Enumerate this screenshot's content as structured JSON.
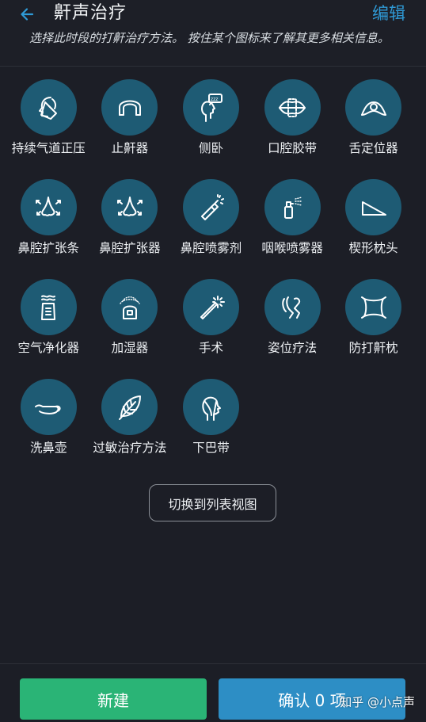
{
  "header": {
    "title": "鼾声治疗",
    "edit_label": "编辑",
    "subtitle": "选择此时段的打鼾治疗方法。 按住某个图标来了解其更多相关信息。"
  },
  "colors": {
    "background": "#1c1e26",
    "icon_circle": "#1e5b74",
    "accent_blue": "#2f9ad6",
    "new_button": "#2ab476",
    "confirm_button": "#2d8ec5"
  },
  "remedies": [
    {
      "label": "持续气道正压",
      "icon": "cpap-mask-icon"
    },
    {
      "label": "止鼾器",
      "icon": "mouthguard-icon"
    },
    {
      "label": "侧卧",
      "icon": "side-sleep-icon"
    },
    {
      "label": "口腔胶带",
      "icon": "mouth-tape-icon"
    },
    {
      "label": "舌定位器",
      "icon": "tongue-retainer-icon"
    },
    {
      "label": "鼻腔扩张条",
      "icon": "nasal-strip-icon"
    },
    {
      "label": "鼻腔扩张器",
      "icon": "nasal-dilator-icon"
    },
    {
      "label": "鼻腔喷雾剂",
      "icon": "nasal-spray-icon"
    },
    {
      "label": "咽喉喷雾器",
      "icon": "throat-spray-icon"
    },
    {
      "label": "楔形枕头",
      "icon": "wedge-pillow-icon"
    },
    {
      "label": "空气净化器",
      "icon": "air-purifier-icon"
    },
    {
      "label": "加湿器",
      "icon": "humidifier-icon"
    },
    {
      "label": "手术",
      "icon": "surgery-wand-icon"
    },
    {
      "label": "姿位疗法",
      "icon": "positional-therapy-icon"
    },
    {
      "label": "防打鼾枕",
      "icon": "anti-snore-pillow-icon"
    },
    {
      "label": "洗鼻壶",
      "icon": "neti-pot-icon"
    },
    {
      "label": "过敏治疗方法",
      "icon": "allergy-leaf-icon"
    },
    {
      "label": "下巴带",
      "icon": "chin-strap-icon"
    }
  ],
  "switch_view_label": "切换到列表视图",
  "footer": {
    "new_label": "新建",
    "confirm_label": "确认 0 项"
  },
  "watermark": "知乎 @小点声"
}
